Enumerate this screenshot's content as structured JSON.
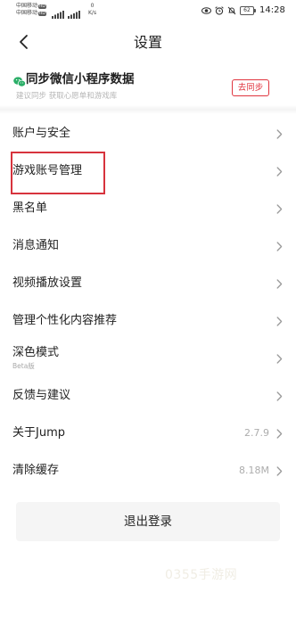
{
  "status_bar": {
    "carrier_1": "中国移动",
    "carrier_1_badge": "HD",
    "carrier_2": "中国移动",
    "carrier_2_badge": "HD",
    "net_speed_value": "0",
    "net_speed_unit": "K/s",
    "battery_level": "62",
    "time": "14:28",
    "icons": [
      "signal-icon",
      "eye-icon",
      "alarm-icon",
      "mute-icon",
      "battery-icon"
    ]
  },
  "header": {
    "title": "设置",
    "back_icon": "back-arrow-icon"
  },
  "sync_card": {
    "icon": "wechat-icon",
    "title": "同步微信小程序数据",
    "subtitle": "建议同步 获取心愿单和游戏库",
    "button_label": "去同步"
  },
  "settings": {
    "chevron_icon": "chevron-right-icon",
    "items": [
      {
        "label": "账户与安全"
      },
      {
        "label": "游戏账号管理"
      },
      {
        "label": "黑名单"
      },
      {
        "label": "消息通知"
      },
      {
        "label": "视频播放设置"
      },
      {
        "label": "管理个性化内容推荐"
      },
      {
        "label": "深色模式",
        "sublabel": "Beta版"
      },
      {
        "label": "反馈与建议"
      },
      {
        "label": "关于Jump",
        "value": "2.7.9"
      },
      {
        "label": "清除缓存",
        "value": "8.18M"
      }
    ]
  },
  "logout": {
    "label": "退出登录"
  },
  "watermark": "0355手游网",
  "colors": {
    "accent_red": "#e0353f",
    "wechat_green": "#2aae67",
    "highlight_red": "#d7333d",
    "text_primary": "#222222",
    "text_secondary": "#adadad",
    "logout_background": "#f5f5f5"
  }
}
